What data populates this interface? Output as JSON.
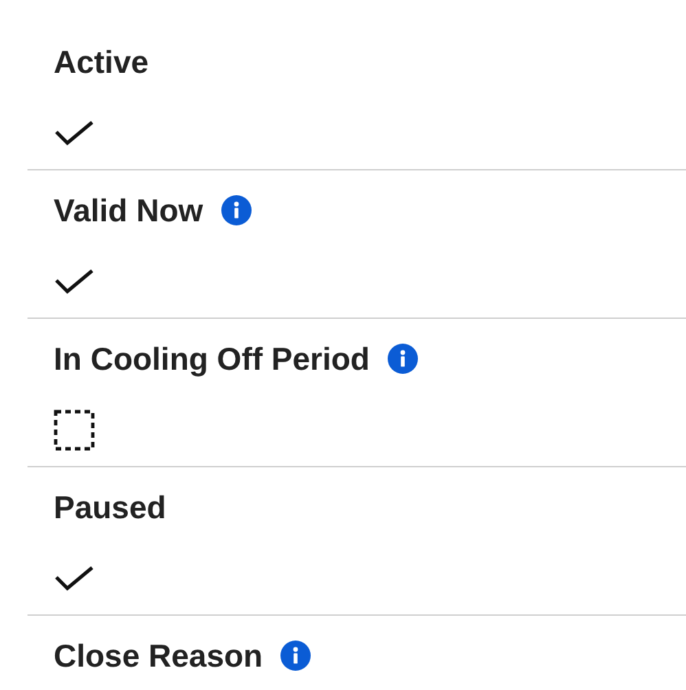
{
  "fields": [
    {
      "label": "Active",
      "info": false,
      "kind": "checkbox",
      "checked": true
    },
    {
      "label": "Valid Now",
      "info": true,
      "kind": "checkbox",
      "checked": true
    },
    {
      "label": "In Cooling Off Period",
      "info": true,
      "kind": "checkbox",
      "checked": false
    },
    {
      "label": "Paused",
      "info": false,
      "kind": "checkbox",
      "checked": true
    },
    {
      "label": "Close Reason",
      "info": true
    }
  ]
}
